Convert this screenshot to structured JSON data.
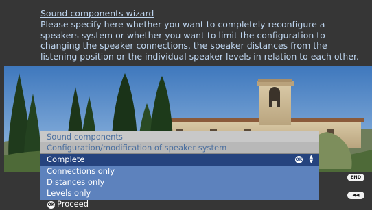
{
  "wizard": {
    "title": "Sound components wizard",
    "description": "Please specify here whether you want to completely reconfigure a speakers system or whether you want to limit the configuration to changing the speaker connections, the speaker distances from the listening position or the individual speaker levels in relation to each other."
  },
  "menu": {
    "header": "Sound components",
    "subheader": "Configuration/modification of speaker system",
    "items": [
      {
        "label": "Complete",
        "selected": true
      },
      {
        "label": "Connections only",
        "selected": false
      },
      {
        "label": "Distances only",
        "selected": false
      },
      {
        "label": "Levels only",
        "selected": false
      }
    ],
    "ok_badge": "OK"
  },
  "keys": {
    "end": "END",
    "back": "◀◀"
  },
  "footer": {
    "ok_badge": "OK",
    "proceed": "Proceed"
  },
  "colors": {
    "background": "#363636",
    "text_light_blue": "#bfd6f0",
    "menu_list": "#5d82bd",
    "menu_selected": "#25437e",
    "menu_header": "#c8c8c8"
  }
}
